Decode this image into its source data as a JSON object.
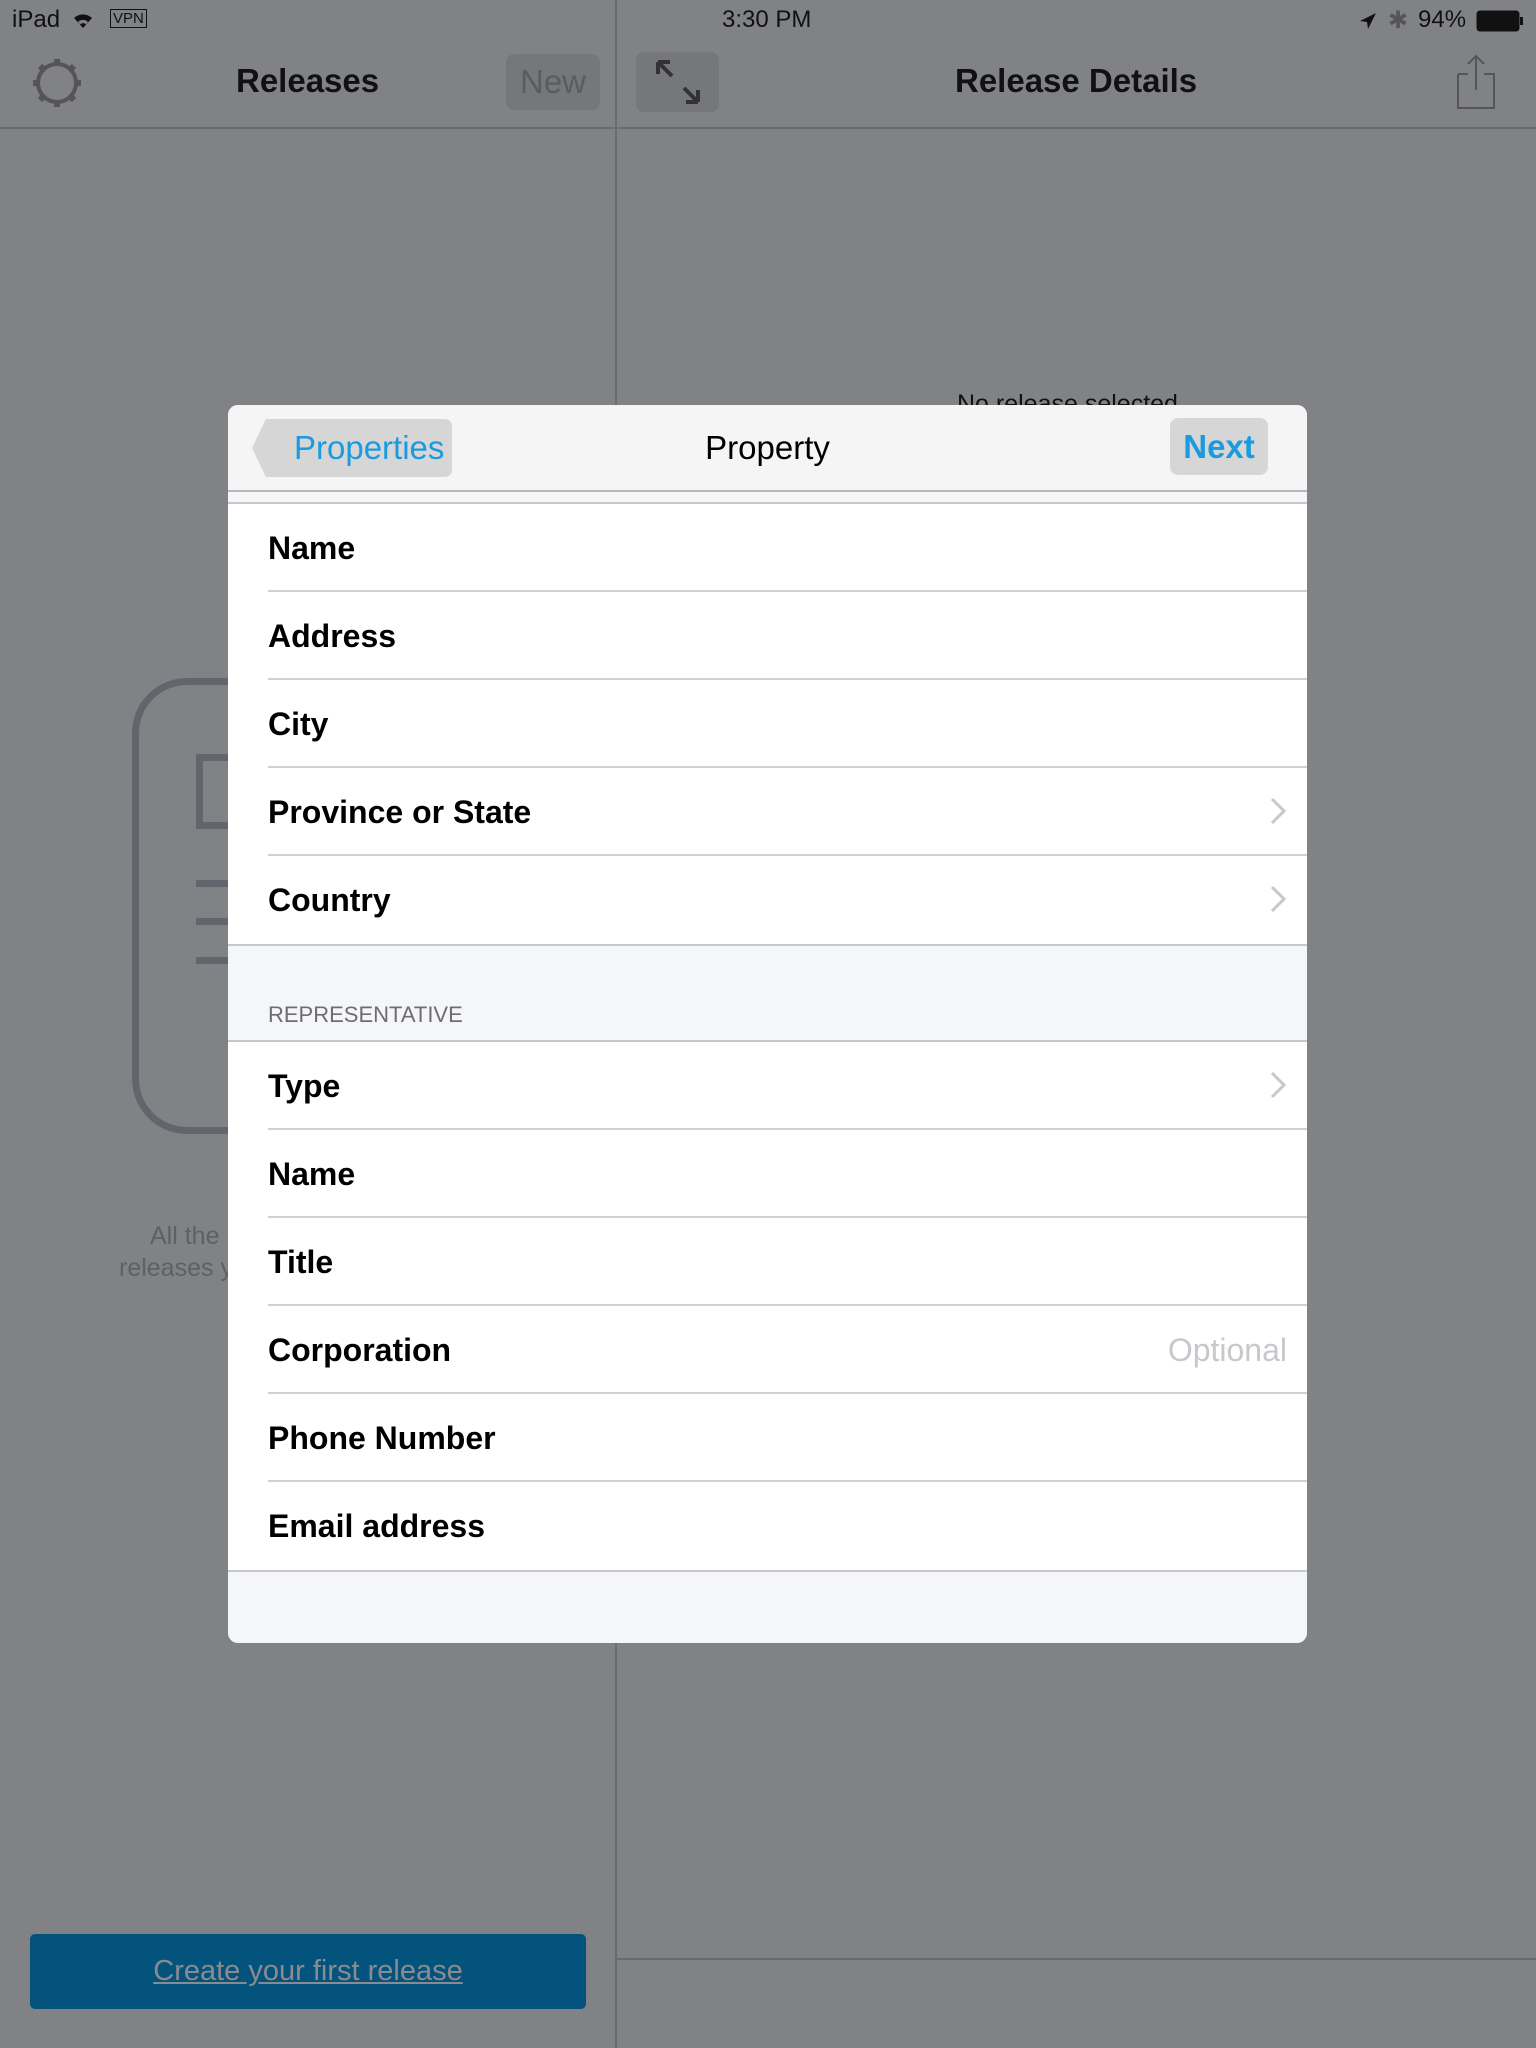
{
  "status_bar": {
    "device": "iPad",
    "vpn": "VPN",
    "time": "3:30 PM",
    "battery": "94%"
  },
  "left_pane": {
    "title": "Releases",
    "new_label": "New",
    "empty_line1": "All the",
    "empty_line2": "releases y",
    "create_label": "Create your first release"
  },
  "right_pane": {
    "title": "Release Details",
    "empty_text": "No release selected"
  },
  "modal": {
    "back_label": "Properties",
    "title": "Property",
    "next_label": "Next",
    "property_rows": [
      {
        "label": "Name"
      },
      {
        "label": "Address"
      },
      {
        "label": "City"
      },
      {
        "label": "Province or State",
        "disclosure": true
      },
      {
        "label": "Country",
        "disclosure": true
      }
    ],
    "section_header": "REPRESENTATIVE",
    "representative_rows": [
      {
        "label": "Type",
        "disclosure": true
      },
      {
        "label": "Name"
      },
      {
        "label": "Title"
      },
      {
        "label": "Corporation",
        "placeholder": "Optional"
      },
      {
        "label": "Phone Number"
      },
      {
        "label": "Email address"
      }
    ]
  },
  "colors": {
    "accent": "#1a9be0",
    "dim_bg": "#818286",
    "create_button": "#04537c"
  }
}
